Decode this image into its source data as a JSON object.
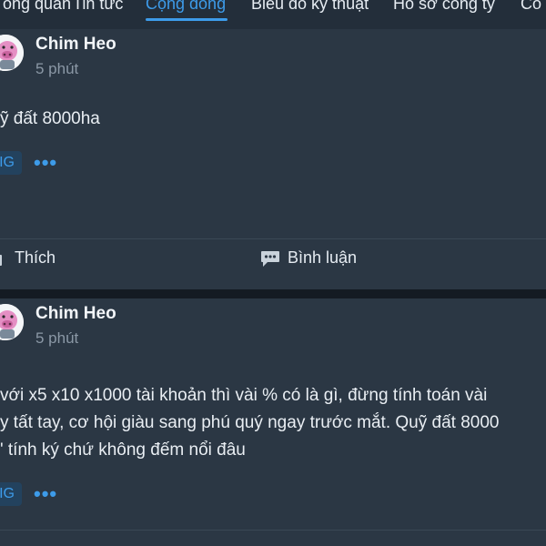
{
  "tabs": [
    {
      "label": "Tổng quan",
      "active": false
    },
    {
      "label": "Tin tức",
      "active": false
    },
    {
      "label": "Cộng đồng",
      "active": true
    },
    {
      "label": "Biểu đồ kỹ thuật",
      "active": false
    },
    {
      "label": "Hồ sơ công ty",
      "active": false
    },
    {
      "label": "Cổ",
      "active": false
    }
  ],
  "posts": [
    {
      "author": "Chim Heo",
      "time": "5 phút",
      "lines": [
        "ỹ đất 8000ha"
      ],
      "tag": "IG",
      "more": "•••",
      "like_label": "Thích",
      "comment_label": "Bình luận"
    },
    {
      "author": "Chim Heo",
      "time": "5 phút",
      "lines": [
        " với x5 x10 x1000 tài khoản thì vài % có là gì, đừng tính toán vài",
        "y tất tay, cơ hội giàu sang phú quý ngay trước mắt. Quỹ đất 8000",
        "' tính ký chứ không đếm nổi đâu"
      ],
      "tag": "IG",
      "more": "•••"
    }
  ],
  "colors": {
    "accent": "#3d9be9",
    "card": "#2b3744",
    "background": "#1a222c",
    "text": "#e9eef3",
    "muted": "#8b98a6"
  }
}
